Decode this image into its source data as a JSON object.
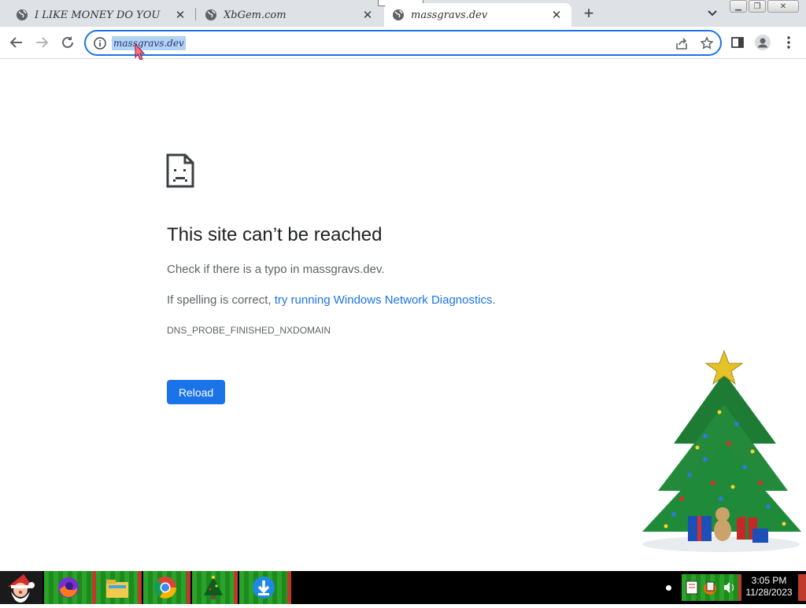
{
  "browser": {
    "tabs": [
      {
        "title": "I LIKE MONEY DO YOU"
      },
      {
        "title": "XbGem.com"
      },
      {
        "title": "massgravs.dev"
      }
    ],
    "new_tab_label": "+",
    "url": "massgravs.dev",
    "accent": "#1a73e8"
  },
  "error_page": {
    "title": "This site can’t be reached",
    "line1": "Check if there is a typo in massgravs.dev.",
    "line2_prefix": "If spelling is correct, ",
    "line2_link": "try running Windows Network Diagnostics",
    "line2_suffix": ".",
    "error_code": "DNS_PROBE_FINISHED_NXDOMAIN",
    "reload_label": "Reload"
  },
  "taskbar": {
    "apps": [
      "start-santa",
      "firefox",
      "file-explorer",
      "chrome",
      "christmas-tree",
      "downloader"
    ],
    "time": "3:05 PM",
    "date": "11/28/2023"
  }
}
